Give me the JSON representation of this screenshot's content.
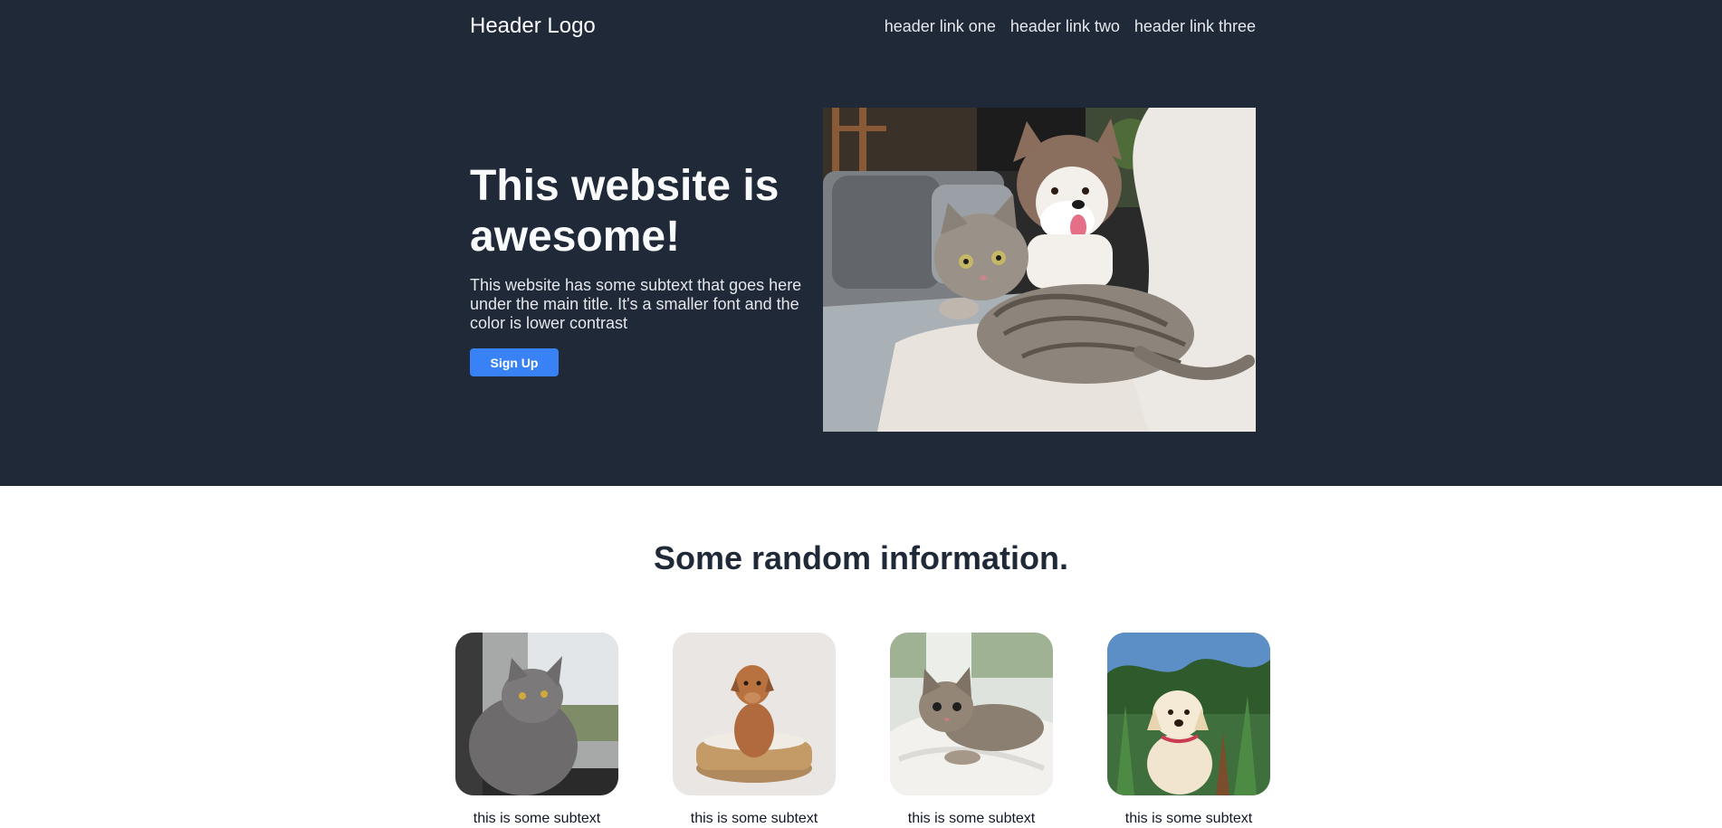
{
  "header": {
    "logo": "Header Logo",
    "links": [
      "header link one",
      "header link two",
      "header link three"
    ]
  },
  "hero": {
    "title": "This website is awesome!",
    "subtext": "This website has some subtext that goes here under the main title. It's a smaller font and the color is lower contrast",
    "button_label": "Sign Up"
  },
  "info": {
    "title": "Some random information.",
    "cards": [
      {
        "subtext": "this is some subtext"
      },
      {
        "subtext": "this is some subtext"
      },
      {
        "subtext": "this is some subtext"
      },
      {
        "subtext": "this is some subtext"
      }
    ]
  },
  "colors": {
    "hero_background": "#1f2937",
    "button": "#3882f6",
    "info_title": "#1f2937"
  }
}
